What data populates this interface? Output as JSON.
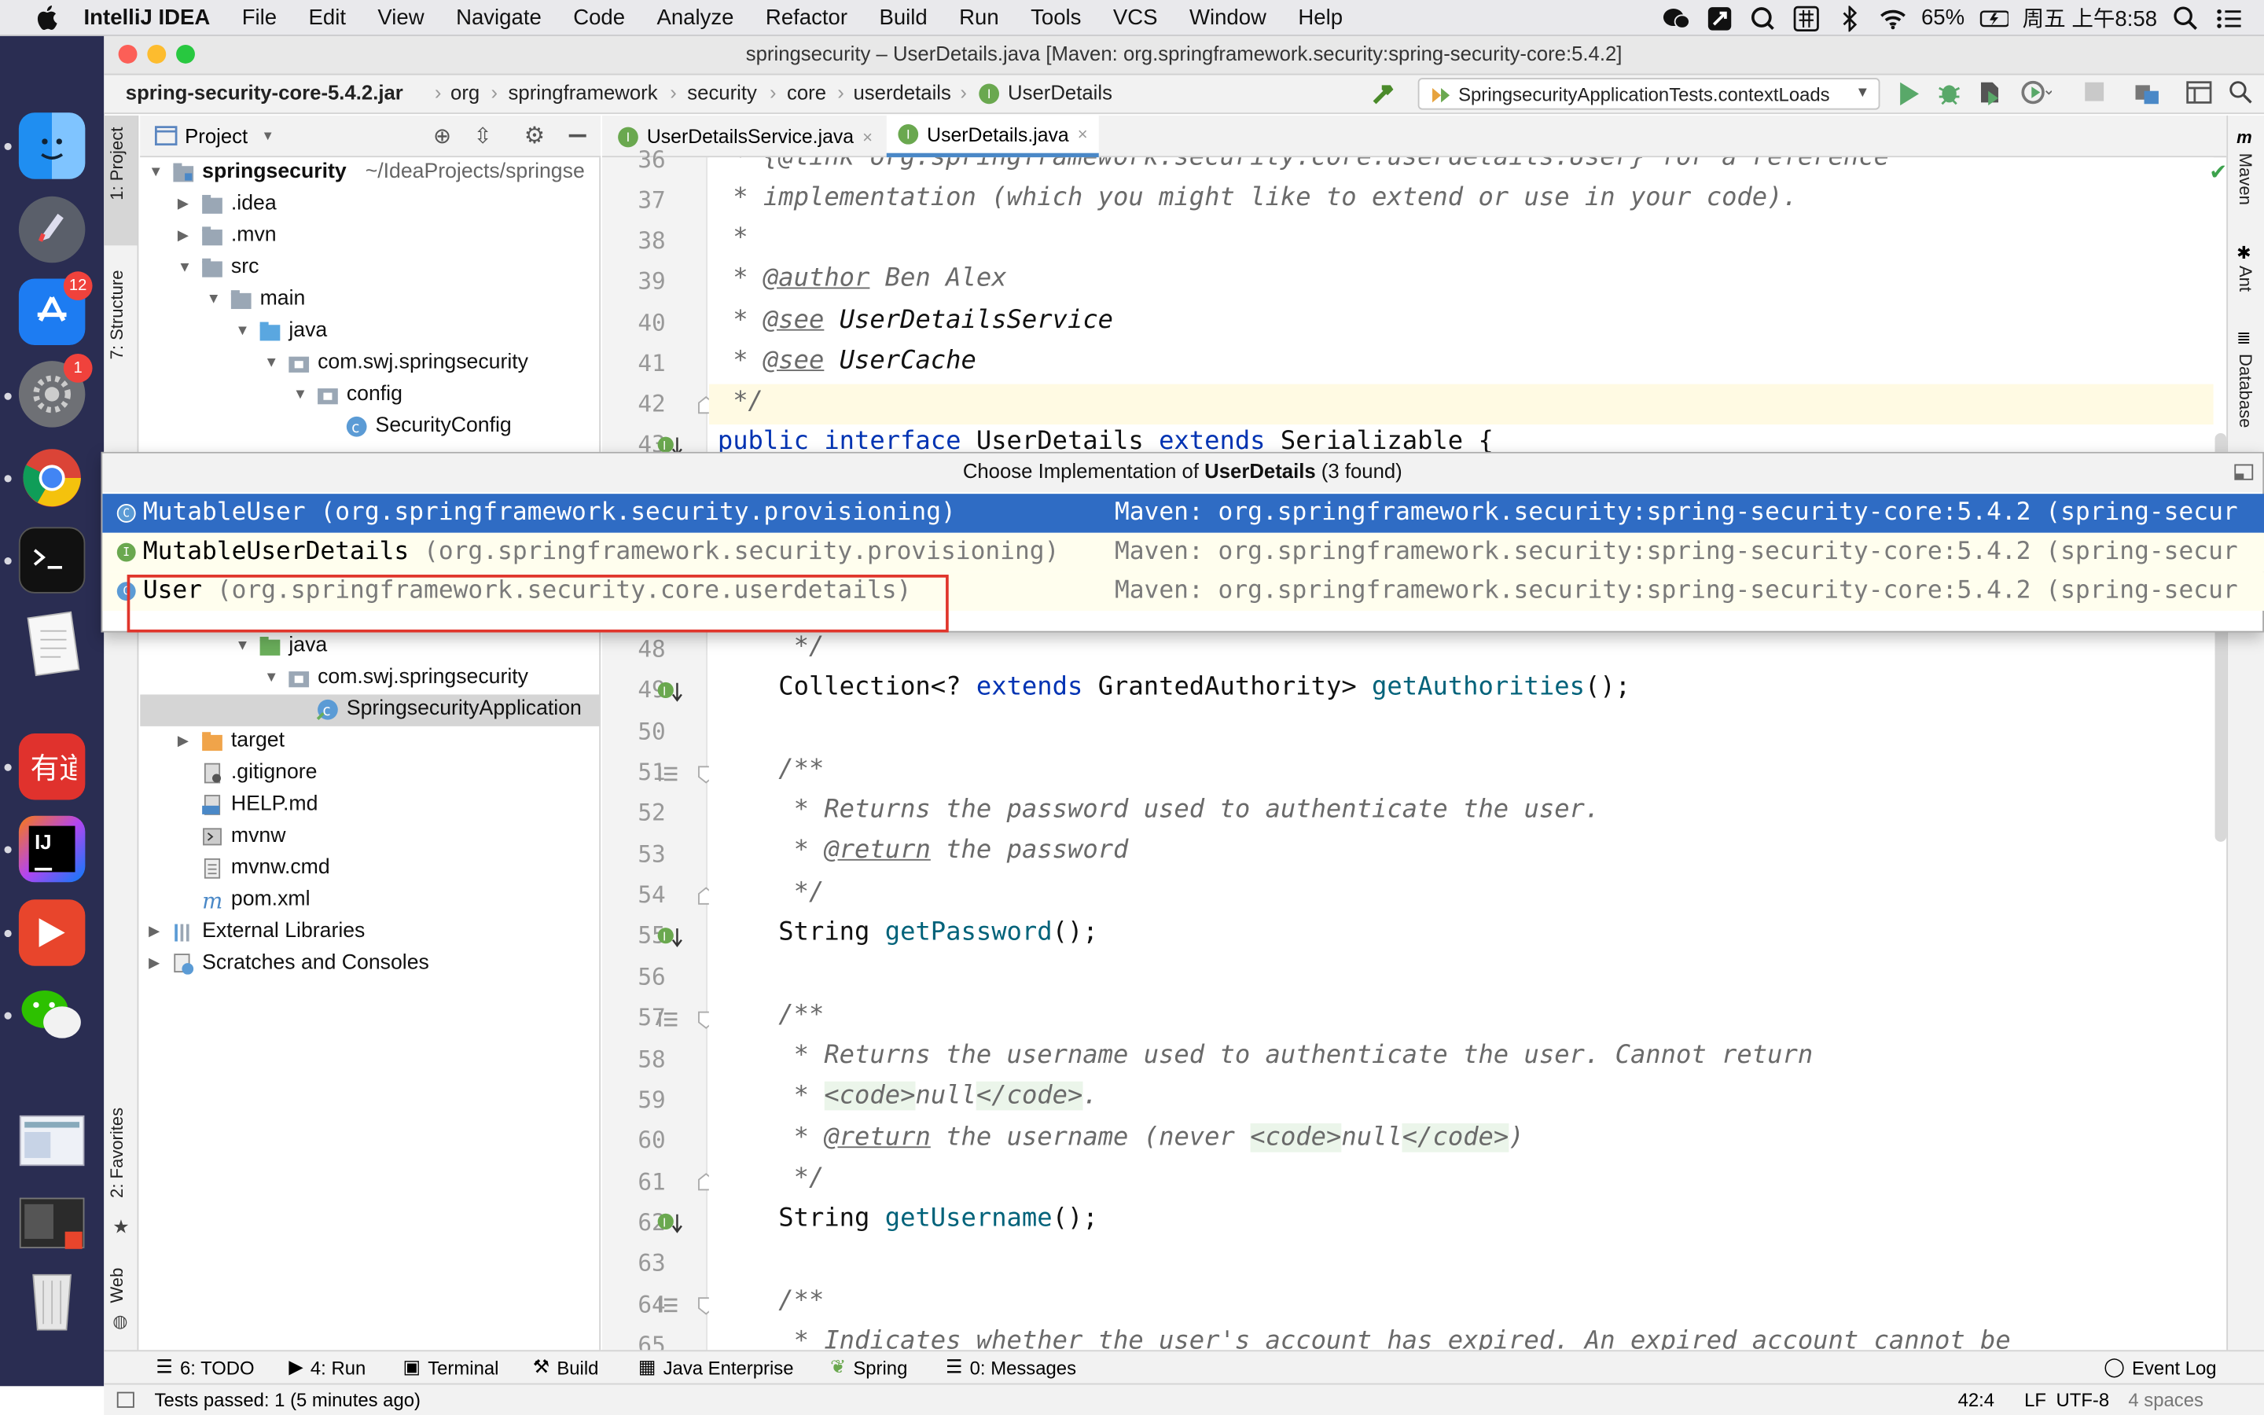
{
  "menubar": {
    "app_name": "IntelliJ IDEA",
    "items": [
      "File",
      "Edit",
      "View",
      "Navigate",
      "Code",
      "Analyze",
      "Refactor",
      "Build",
      "Run",
      "Tools",
      "VCS",
      "Window",
      "Help"
    ],
    "battery": "65%",
    "clock": "周五 上午8:58"
  },
  "dock": {
    "app_store_badge": "12",
    "settings_badge": "1"
  },
  "window": {
    "title": "springsecurity – UserDetails.java [Maven: org.springframework.security:spring-security-core:5.4.2]"
  },
  "breadcrumb": [
    "spring-security-core-5.4.2.jar",
    "org",
    "springframework",
    "security",
    "core",
    "userdetails",
    "UserDetails"
  ],
  "run_config": "SpringsecurityApplicationTests.contextLoads",
  "side_tools": {
    "left_top": [
      "1: Project",
      "7: Structure"
    ],
    "left_bottom": [
      "2: Favorites",
      "Web"
    ],
    "right": [
      "Maven",
      "Ant",
      "Database"
    ]
  },
  "project_panel": {
    "title": "Project",
    "tree": [
      {
        "label": "springsecurity",
        "suffix": "~/IdeaProjects/springse",
        "bold": true
      },
      {
        "label": ".idea"
      },
      {
        "label": ".mvn"
      },
      {
        "label": "src"
      },
      {
        "label": "main"
      },
      {
        "label": "java"
      },
      {
        "label": "com.swj.springsecurity"
      },
      {
        "label": "config"
      },
      {
        "label": "SecurityConfig"
      },
      {
        "label": "java"
      },
      {
        "label": "com.swj.springsecurity"
      },
      {
        "label": "SpringsecurityApplication"
      },
      {
        "label": "target"
      },
      {
        "label": ".gitignore"
      },
      {
        "label": "HELP.md"
      },
      {
        "label": "mvnw"
      },
      {
        "label": "mvnw.cmd"
      },
      {
        "label": "pom.xml"
      },
      {
        "label": "External Libraries"
      },
      {
        "label": "Scratches and Consoles"
      }
    ]
  },
  "tabs": [
    {
      "label": "UserDetailsService.java"
    },
    {
      "label": "UserDetails.java"
    }
  ],
  "line_numbers_top": [
    "36",
    "37",
    "38",
    "39",
    "40",
    "41",
    "42",
    "43"
  ],
  "line_numbers": [
    "48",
    "49",
    "50",
    "51",
    "52",
    "53",
    "54",
    "55",
    "56",
    "57",
    "58",
    "59",
    "60",
    "61",
    "62",
    "63",
    "64",
    "65"
  ],
  "code": {
    "l36": " * {@link org.springframework.security.core.userdetails.User} for a reference",
    "l37": " * implementation (which you might like to extend or use in your code).",
    "l38": " *",
    "l39_a": " * ",
    "l39_tag": "@author",
    "l39_b": " Ben Alex",
    "l40_a": " * ",
    "l40_tag": "@see",
    "l40_b": " UserDetailsService",
    "l41_a": " * ",
    "l41_tag": "@see",
    "l41_b": " UserCache",
    "l42": " */",
    "l43_kw1": "public interface",
    "l43_b": " UserDetails ",
    "l43_kw2": "extends",
    "l43_c": " Serializable {",
    "l48": "     */",
    "l49_a": "    Collection<? ",
    "l49_kw": "extends",
    "l49_b": " GrantedAuthority> ",
    "l49_fn": "getAuthorities",
    "l49_c": "();",
    "l51": "    /**",
    "l52": "     * Returns the password used to authenticate the user.",
    "l53_a": "     * ",
    "l53_tag": "@return",
    "l53_b": " the password",
    "l54": "     */",
    "l55_a": "    String ",
    "l55_fn": "getPassword",
    "l55_b": "();",
    "l57": "    /**",
    "l58": "     * Returns the username used to authenticate the user. Cannot return",
    "l59_a": "     * ",
    "l59_t1": "<code>",
    "l59_b": "null",
    "l59_t2": "</code>",
    "l59_c": ".",
    "l60_a": "     * ",
    "l60_tag": "@return",
    "l60_b": " the username (never ",
    "l60_t1": "<code>",
    "l60_c": "null",
    "l60_t2": "</code>",
    "l60_d": ")",
    "l61": "     */",
    "l62_a": "    String ",
    "l62_fn": "getUsername",
    "l62_b": "();",
    "l64": "    /**",
    "l65": "     * Indicates whether the user's account has expired. An expired account cannot be"
  },
  "popup": {
    "title_prefix": "Choose Implementation of ",
    "title_bold": "UserDetails",
    "title_suffix": " (3 found)",
    "items": [
      {
        "name": "MutableUser",
        "pkg": " (org.springframework.security.provisioning)",
        "maven": "Maven: org.springframework.security:spring-security-core:5.4.2 (spring-secur",
        "kind": "C"
      },
      {
        "name": "MutableUserDetails",
        "pkg": " (org.springframework.security.provisioning)",
        "maven": "Maven: org.springframework.security:spring-security-core:5.4.2 (spring-secur",
        "kind": "I"
      },
      {
        "name": "User",
        "pkg": " (org.springframework.security.core.userdetails)",
        "maven": "Maven: org.springframework.security:spring-security-core:5.4.2 (spring-secur",
        "kind": "C"
      }
    ]
  },
  "tool_windows": [
    {
      "label": "6: TODO"
    },
    {
      "label": "4: Run"
    },
    {
      "label": "Terminal"
    },
    {
      "label": "Build"
    },
    {
      "label": "Java Enterprise"
    },
    {
      "label": "Spring"
    },
    {
      "label": "0: Messages"
    },
    {
      "label": "Event Log"
    }
  ],
  "status": {
    "message": "Tests passed: 1 (5 minutes ago)",
    "position": "42:4",
    "line_sep": "LF",
    "encoding": "UTF-8",
    "indent": "4 spaces"
  },
  "colors": {
    "selection": "#2f6cc4",
    "highlight_box": "#e0352b",
    "tab_underline": "#4a88c7"
  }
}
